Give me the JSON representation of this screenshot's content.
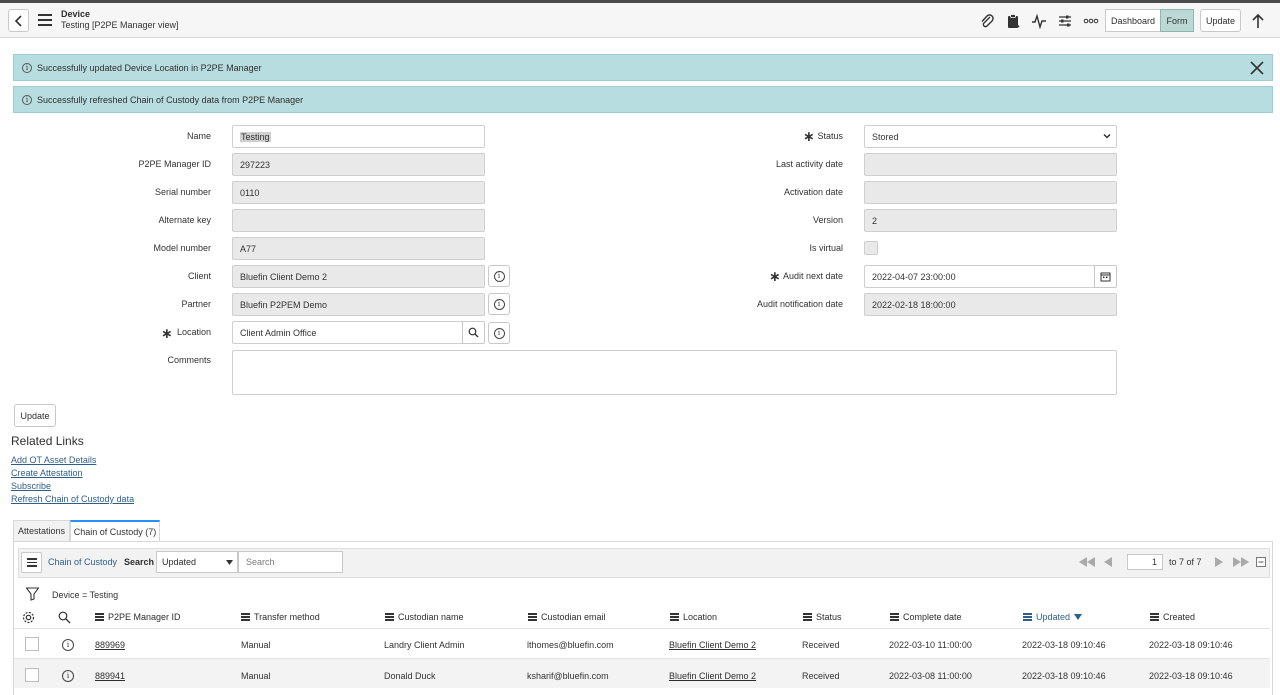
{
  "header": {
    "title": "Device",
    "subtitle": "Testing [P2PE Manager view]",
    "buttons": {
      "dashboard": "Dashboard",
      "form": "Form",
      "update": "Update"
    }
  },
  "alerts": [
    {
      "text": "Successfully updated Device Location in P2PE Manager"
    },
    {
      "text": "Successfully refreshed Chain of Custody data from P2PE Manager"
    }
  ],
  "form": {
    "left": {
      "name": {
        "label": "Name",
        "value": "Testing"
      },
      "p2pe_manager_id": {
        "label": "P2PE Manager ID",
        "value": "297223"
      },
      "serial_number": {
        "label": "Serial number",
        "value": "0110"
      },
      "alternate_key": {
        "label": "Alternate key",
        "value": ""
      },
      "model_number": {
        "label": "Model number",
        "value": "A77"
      },
      "client": {
        "label": "Client",
        "value": "Bluefin Client Demo 2"
      },
      "partner": {
        "label": "Partner",
        "value": "Bluefin P2PEM Demo"
      },
      "location": {
        "label": "Location",
        "value": "Client Admin Office"
      },
      "comments": {
        "label": "Comments",
        "value": ""
      }
    },
    "right": {
      "status": {
        "label": "Status",
        "value": "Stored"
      },
      "last_activity_date": {
        "label": "Last activity date",
        "value": ""
      },
      "activation_date": {
        "label": "Activation date",
        "value": ""
      },
      "version": {
        "label": "Version",
        "value": "2"
      },
      "is_virtual": {
        "label": "Is virtual",
        "checked": false
      },
      "audit_next_date": {
        "label": "Audit next date",
        "value": "2022-04-07 23:00:00"
      },
      "audit_notification_date": {
        "label": "Audit notification date",
        "value": "2022-02-18 18:00:00"
      }
    },
    "update_label": "Update"
  },
  "related_links": {
    "title": "Related Links",
    "items": [
      "Add OT Asset Details",
      "Create Attestation",
      "Subscribe",
      "Refresh Chain of Custody data"
    ]
  },
  "tabs": [
    {
      "label": "Attestations",
      "active": false
    },
    {
      "label": "Chain of Custody (7)",
      "active": true
    }
  ],
  "list": {
    "title": "Chain of Custody",
    "search_label": "Search",
    "search_field": "Updated",
    "search_placeholder": "Search",
    "page": "1",
    "page_info": "to 7 of 7",
    "filter": "Device = Testing",
    "columns": [
      "P2PE Manager ID",
      "Transfer method",
      "Custodian name",
      "Custodian email",
      "Location",
      "Status",
      "Complete date",
      "Updated",
      "Created"
    ],
    "sorted_column": "Updated",
    "rows": [
      [
        "889969",
        "Manual",
        "Landry Client Admin",
        "lthomes@bluefin.com",
        "Bluefin Client Demo 2",
        "Received",
        "2022-03-10 11:00:00",
        "2022-03-18 09:10:46",
        "2022-03-18 09:10:46"
      ],
      [
        "889941",
        "Manual",
        "Donald Duck",
        "ksharif@bluefin.com",
        "Bluefin Client Demo 2",
        "Received",
        "2022-03-08 11:00:00",
        "2022-03-18 09:10:46",
        "2022-03-18 09:10:46"
      ]
    ]
  },
  "icons": {
    "back": "chevron-left-icon",
    "menu": "hamburger-icon",
    "attachment": "paperclip-icon",
    "clipboard": "clipboard-icon",
    "activity": "activity-icon",
    "settings": "sliders-icon",
    "more": "more-icon",
    "scroll_up": "arrow-up-icon"
  },
  "colors": {
    "alert_bg": "#b8dde0",
    "active_toggle": "#bcd8d5",
    "link": "#2e5f8a"
  }
}
